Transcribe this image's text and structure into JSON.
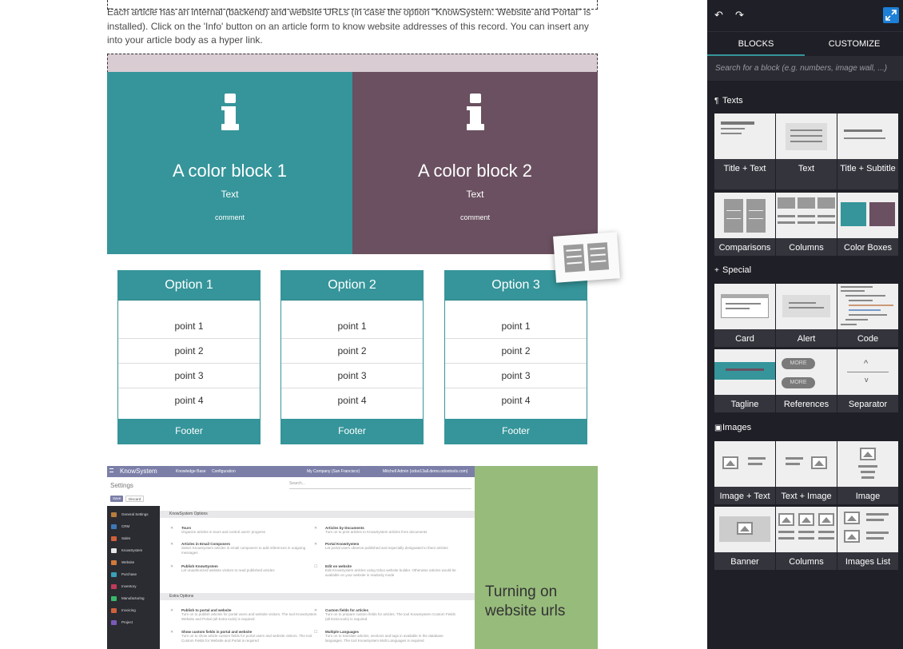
{
  "intro_text": "Each article has an internal (backend) and website URLs (in case the option \"KnowSystem: Website and Portal\" is installed). Click on the 'Info' button on an article form to know website addresses of this record. You can insert any into your article body as a hyper link.",
  "color_blocks": [
    {
      "title": "A color block 1",
      "text": "Text",
      "comment": "comment",
      "color": "#35959a"
    },
    {
      "title": "A color block 2",
      "text": "Text",
      "comment": "comment",
      "color": "#6a5060"
    }
  ],
  "options": [
    {
      "title": "Option 1",
      "points": [
        "point 1",
        "point 2",
        "point 3",
        "point 4"
      ],
      "footer": "Footer"
    },
    {
      "title": "Option 2",
      "points": [
        "point 1",
        "point 2",
        "point 3",
        "point 4"
      ],
      "footer": "Footer"
    },
    {
      "title": "Option 3",
      "points": [
        "point 1",
        "point 2",
        "point 3",
        "point 4"
      ],
      "footer": "Footer"
    }
  ],
  "screenshot": {
    "brand": "KnowSystem",
    "menu": [
      "Knowledge Base",
      "Configuration"
    ],
    "company": "My Company (San Francisco)",
    "user": "Mitchell Admin (odoo13all.demo.odootools.com)",
    "page_title": "Settings",
    "search_placeholder": "Search...",
    "save": "Save",
    "discard": "Discard",
    "sidebar": [
      "General Settings",
      "CRM",
      "Sales",
      "KnowSystem",
      "Website",
      "Purchase",
      "Inventory",
      "Manufacturing",
      "Invoicing",
      "Project"
    ],
    "section1": "KnowSystem Options",
    "section2": "Extra Options",
    "opts": [
      {
        "t": "Tours",
        "d": "Organize articles in tours and control users' progress"
      },
      {
        "t": "Articles by Documents",
        "d": "Turn on to print articles to KnowSystem articles from documents"
      },
      {
        "t": "Articles in Email Composers",
        "d": "Select KnowSystem articles in email composers to add references in outgoing messages"
      },
      {
        "t": "Portal KnowSystem",
        "d": "Let portal users observe published and especially designated to them articles"
      },
      {
        "t": "Publish KnowSystem",
        "d": "Let unauthorized website visitors to read published articles"
      },
      {
        "t": "Edit on website",
        "d": "Edit KnowSystem articles using Odoo website builder. Otherwise articles would be available on your website in readonly mode"
      },
      {
        "t": "Publish to portal and website",
        "d": "Turn on to publish articles for portal users and website visitors. The tool KnowSystem Website and Portal (all Extra tools) is required"
      },
      {
        "t": "Custom fields for articles",
        "d": "Turn on to prepare custom fields for articles. The tool KnowSystem Custom Fields (all Extra tools) is required"
      },
      {
        "t": "Show custom fields in portal and website",
        "d": "Turn on to show article custom fields for portal users and website visitors. The tool Custom Fields for Website and Portal is required"
      },
      {
        "t": "Multiple Languages",
        "d": "Turn on to translate articles, sections and tags in available in the database languages. The tool KnowSystem Multi Languages is required"
      }
    ]
  },
  "green_text": "Turning on website urls",
  "panel": {
    "tabs": [
      "BLOCKS",
      "CUSTOMIZE"
    ],
    "search_placeholder": "Search for a block (e.g. numbers, image wall, ...)",
    "categories": [
      {
        "icon": "¶",
        "name": "Texts",
        "blocks": [
          "Title + Text",
          "Text",
          "Title + Subtitle",
          "Comparisons",
          "Columns",
          "Color Boxes"
        ]
      },
      {
        "icon": "+",
        "name": "Special",
        "blocks": [
          "Card",
          "Alert",
          "Code",
          "Tagline",
          "References",
          "Separator"
        ]
      },
      {
        "icon": "▣",
        "name": "Images",
        "blocks": [
          "Image + Text",
          "Text + Image",
          "Image",
          "Banner",
          "Columns",
          "Images List"
        ]
      }
    ],
    "references_pill": "MORE",
    "accent": "#35959a"
  },
  "icons": [
    "undo-icon",
    "redo-icon",
    "expand-icon",
    "info-icon",
    "image-icon"
  ]
}
